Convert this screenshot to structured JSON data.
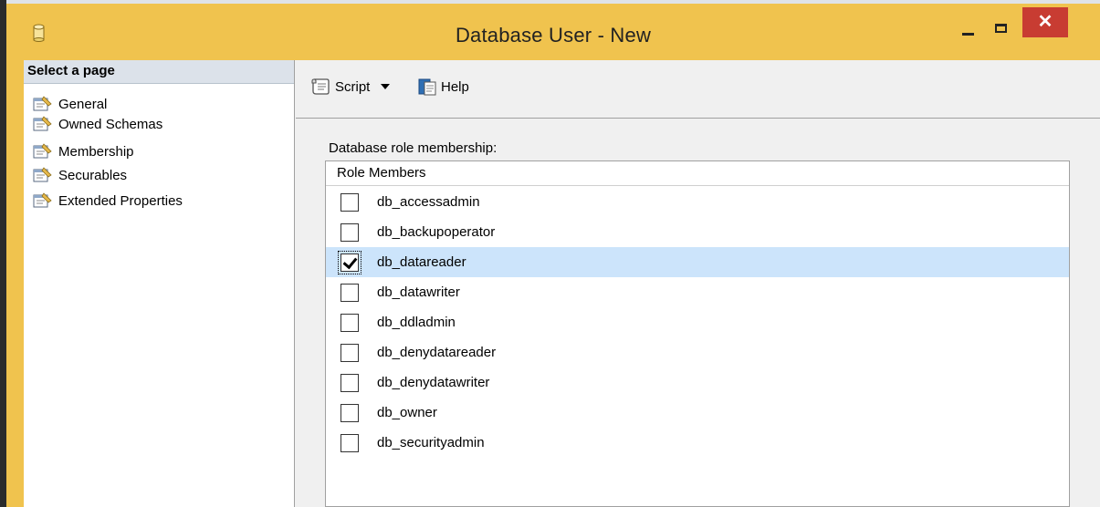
{
  "window": {
    "title": "Database User - New",
    "close_glyph": "✕"
  },
  "nav": {
    "header": "Select a page",
    "items": [
      {
        "label": "General",
        "icon": "page-properties-icon"
      },
      {
        "label": "Owned Schemas",
        "icon": "page-properties-icon"
      },
      {
        "label": "Membership",
        "icon": "page-properties-icon"
      },
      {
        "label": "Securables",
        "icon": "page-properties-icon"
      },
      {
        "label": "Extended Properties",
        "icon": "page-properties-icon"
      }
    ]
  },
  "toolbar": {
    "script_label": "Script",
    "help_label": "Help"
  },
  "membership": {
    "section_label": "Database role membership:",
    "column_header": "Role Members",
    "roles": [
      {
        "name": "db_accessadmin",
        "checked": false
      },
      {
        "name": "db_backupoperator",
        "checked": false
      },
      {
        "name": "db_datareader",
        "checked": true
      },
      {
        "name": "db_datawriter",
        "checked": false
      },
      {
        "name": "db_ddladmin",
        "checked": false
      },
      {
        "name": "db_denydatareader",
        "checked": false
      },
      {
        "name": "db_denydatawriter",
        "checked": false
      },
      {
        "name": "db_owner",
        "checked": false
      },
      {
        "name": "db_securityadmin",
        "checked": false
      }
    ]
  },
  "colors": {
    "title_bar": "#f0c34e",
    "close_button": "#c83c32",
    "selected_row": "#cce4fb"
  }
}
